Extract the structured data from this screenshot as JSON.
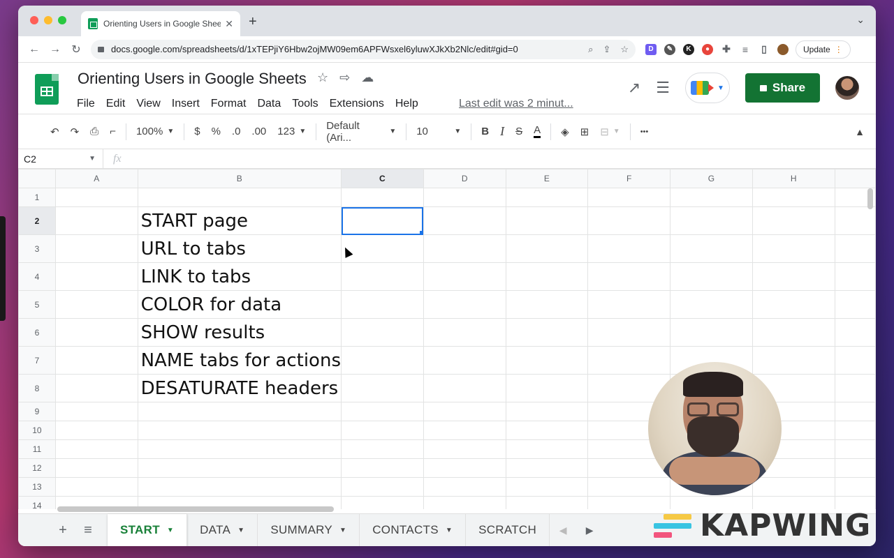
{
  "browser": {
    "tab_title": "Orienting Users in Google Sheets",
    "tab_close": "✕",
    "new_tab": "+",
    "tabs_menu": "⌄",
    "url": "docs.google.com/spreadsheets/d/1xTEPjiY6Hbw2ojMW09em6APFWsxel6yluwXJkXb2Nlc/edit#gid=0",
    "update_label": "Update"
  },
  "doc": {
    "title": "Orienting Users in Google Sheets",
    "menu": [
      "File",
      "Edit",
      "View",
      "Insert",
      "Format",
      "Data",
      "Tools",
      "Extensions",
      "Help"
    ],
    "last_edit": "Last edit was 2 minut...",
    "share_label": "Share"
  },
  "toolbar": {
    "zoom": "100%",
    "currency": "$",
    "percent": "%",
    "dec_decrease": ".0",
    "dec_increase": ".00",
    "number_format": "123",
    "font": "Default (Ari...",
    "font_size": "10",
    "bold": "B",
    "italic": "I",
    "strike": "S",
    "text_color": "A",
    "more": "•••"
  },
  "formula_bar": {
    "cell_ref": "C2",
    "fx": "fx",
    "content": ""
  },
  "grid": {
    "columns": [
      "A",
      "B",
      "C",
      "D",
      "E",
      "F",
      "G",
      "H"
    ],
    "selected_cell": "C2",
    "rows": [
      {
        "num": "1",
        "B": ""
      },
      {
        "num": "2",
        "B": "START page"
      },
      {
        "num": "3",
        "B": "URL to tabs"
      },
      {
        "num": "4",
        "B": "LINK to tabs"
      },
      {
        "num": "5",
        "B": "COLOR for data"
      },
      {
        "num": "6",
        "B": "SHOW results"
      },
      {
        "num": "7",
        "B": "NAME tabs for actions"
      },
      {
        "num": "8",
        "B": "DESATURATE headers"
      },
      {
        "num": "9",
        "B": ""
      },
      {
        "num": "10",
        "B": ""
      },
      {
        "num": "11",
        "B": ""
      },
      {
        "num": "12",
        "B": ""
      },
      {
        "num": "13",
        "B": ""
      },
      {
        "num": "14",
        "B": ""
      }
    ]
  },
  "sheet_tabs": {
    "add": "+",
    "all_sheets": "≡",
    "tabs": [
      "START",
      "DATA",
      "SUMMARY",
      "CONTACTS",
      "SCRATCH"
    ],
    "active": "START"
  },
  "watermark": {
    "text": "KAPWING"
  },
  "colors": {
    "sheets_green": "#0f9d58",
    "share_green": "#137333",
    "selection_blue": "#1a73e8",
    "active_tab_green": "#188038"
  }
}
